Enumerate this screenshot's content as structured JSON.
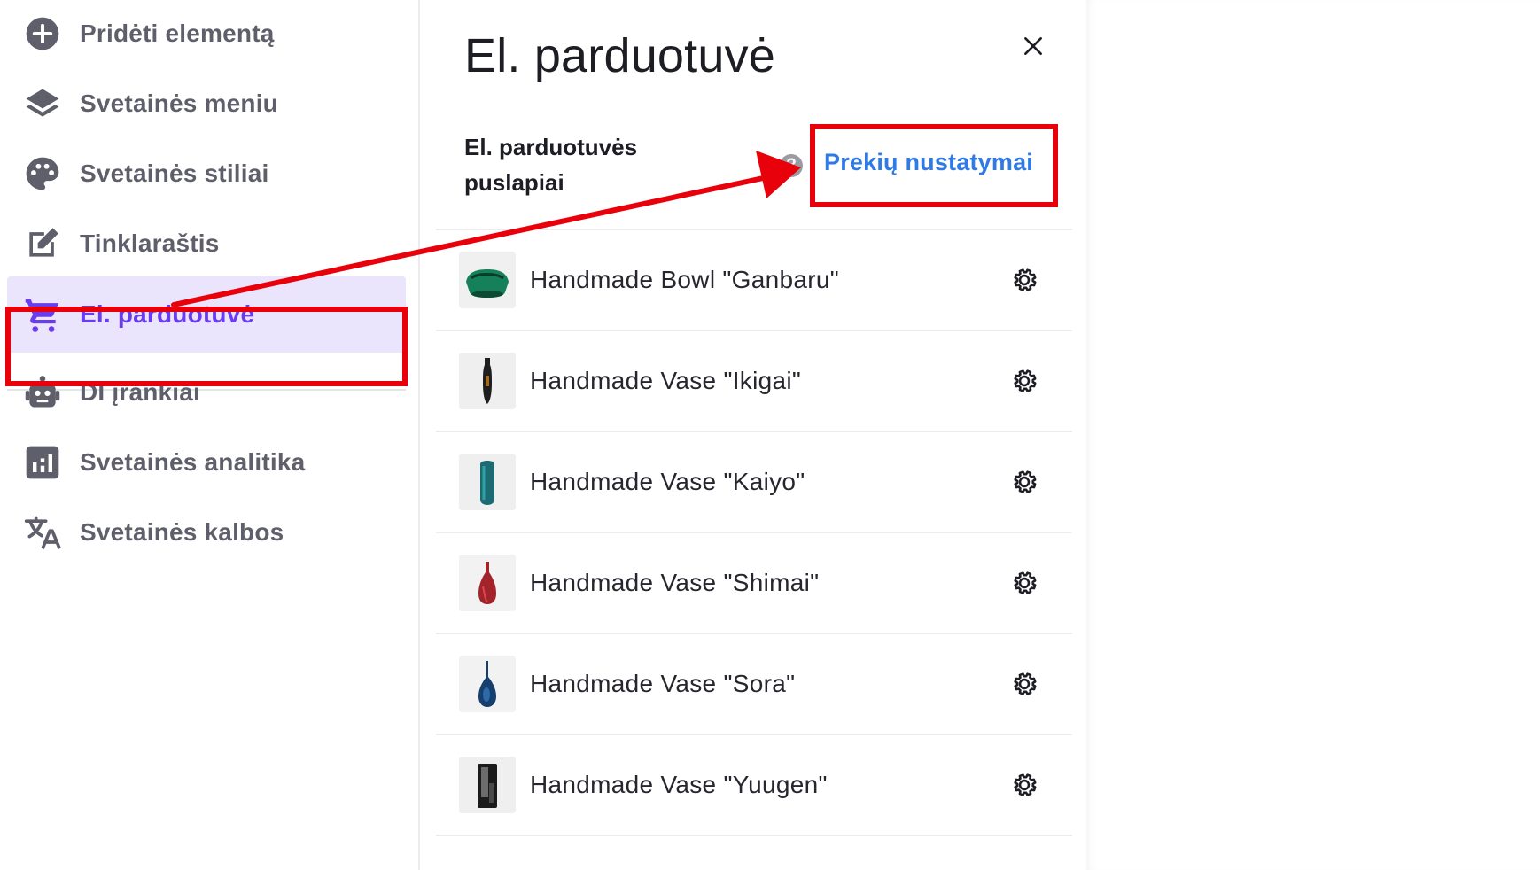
{
  "sidebar": {
    "items": [
      {
        "label": "Pridėti elementą",
        "icon": "add-circle-icon"
      },
      {
        "label": "Svetainės meniu",
        "icon": "layers-icon"
      },
      {
        "label": "Svetainės stiliai",
        "icon": "palette-icon"
      },
      {
        "label": "Tinklaraštis",
        "icon": "edit-icon"
      },
      {
        "label": "El. parduotuvė",
        "icon": "cart-icon",
        "active": true
      },
      {
        "label": "DI įrankiai",
        "icon": "robot-icon"
      },
      {
        "label": "Svetainės analitika",
        "icon": "analytics-icon"
      },
      {
        "label": "Svetainės kalbos",
        "icon": "translate-icon"
      }
    ]
  },
  "panel": {
    "title": "El. parduotuvė",
    "section_title": "El. parduotuvės puslapiai",
    "help": "?",
    "settings_link": "Prekių nustatymai",
    "products": [
      {
        "name": "Handmade Bowl \"Ganbaru\"",
        "thumb": "green bowl"
      },
      {
        "name": "Handmade Vase \"Ikigai\"",
        "thumb": "black vase"
      },
      {
        "name": "Handmade Vase \"Kaiyo\"",
        "thumb": "teal vase"
      },
      {
        "name": "Handmade Vase \"Shimai\"",
        "thumb": "red vase"
      },
      {
        "name": "Handmade Vase \"Sora\"",
        "thumb": "blue vase"
      },
      {
        "name": "Handmade Vase \"Yuugen\"",
        "thumb": "grey vase"
      }
    ]
  },
  "colors": {
    "accent": "#6a3cf0",
    "active_bg": "#ebe4fd",
    "link": "#2f7ae5",
    "annotation": "#e8000b",
    "nav_text": "#5f5f6b"
  }
}
